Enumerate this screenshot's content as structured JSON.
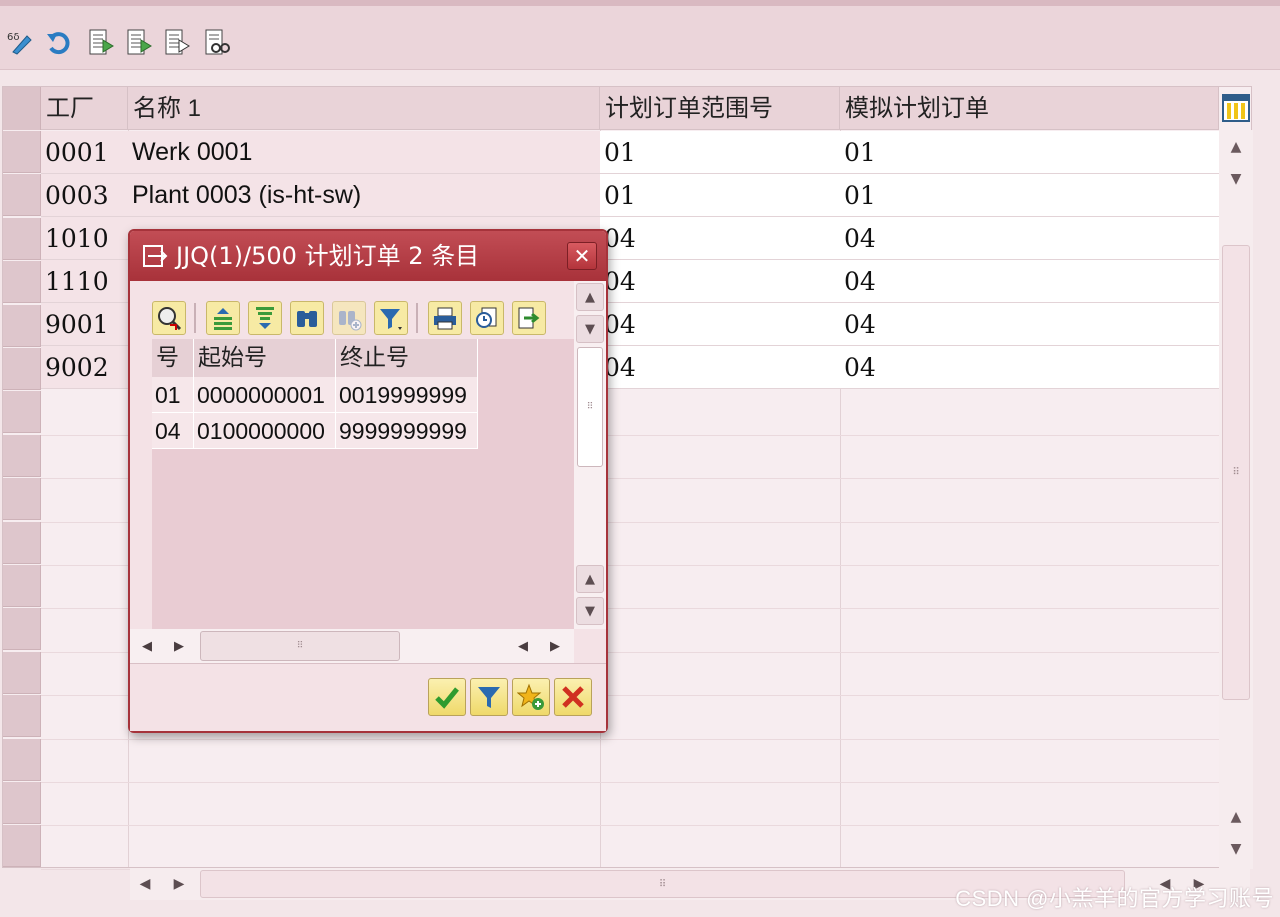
{
  "toolbar": {
    "icons": [
      "display-change-icon",
      "undo-icon",
      "export-doc-icon-1",
      "export-doc-icon-2",
      "export-doc-icon-3",
      "find-doc-icon"
    ]
  },
  "grid": {
    "columns": [
      "工厂",
      "名称 1",
      "计划订单范围号",
      "模拟计划订单"
    ],
    "rows": [
      {
        "plant": "0001",
        "name": "Werk 0001",
        "range": "01",
        "sim": "01"
      },
      {
        "plant": "0003",
        "name": "Plant 0003 (is-ht-sw)",
        "range": "01",
        "sim": "01"
      },
      {
        "plant": "1010",
        "name": "",
        "range": "04",
        "sim": "04"
      },
      {
        "plant": "1110",
        "name": "",
        "range": "04",
        "sim": "04"
      },
      {
        "plant": "9001",
        "name": "",
        "range": "04",
        "sim": "04"
      },
      {
        "plant": "9002",
        "name": "",
        "range": "04",
        "sim": "04"
      }
    ]
  },
  "dialog": {
    "title": "JJQ(1)/500 计划订单 2 条目",
    "close_label": "✕",
    "columns": [
      "号",
      "起始号",
      "终止号"
    ],
    "rows": [
      {
        "no": "01",
        "from": "0000000001",
        "to": "0019999999"
      },
      {
        "no": "04",
        "from": "0100000000",
        "to": "9999999999"
      }
    ]
  },
  "watermark": "CSDN @小羔羊的官方学习账号",
  "colors": {
    "accent": "#a8323a",
    "grid_bg": "#f7edf0",
    "toolbar_bg": "#ebd5da"
  }
}
